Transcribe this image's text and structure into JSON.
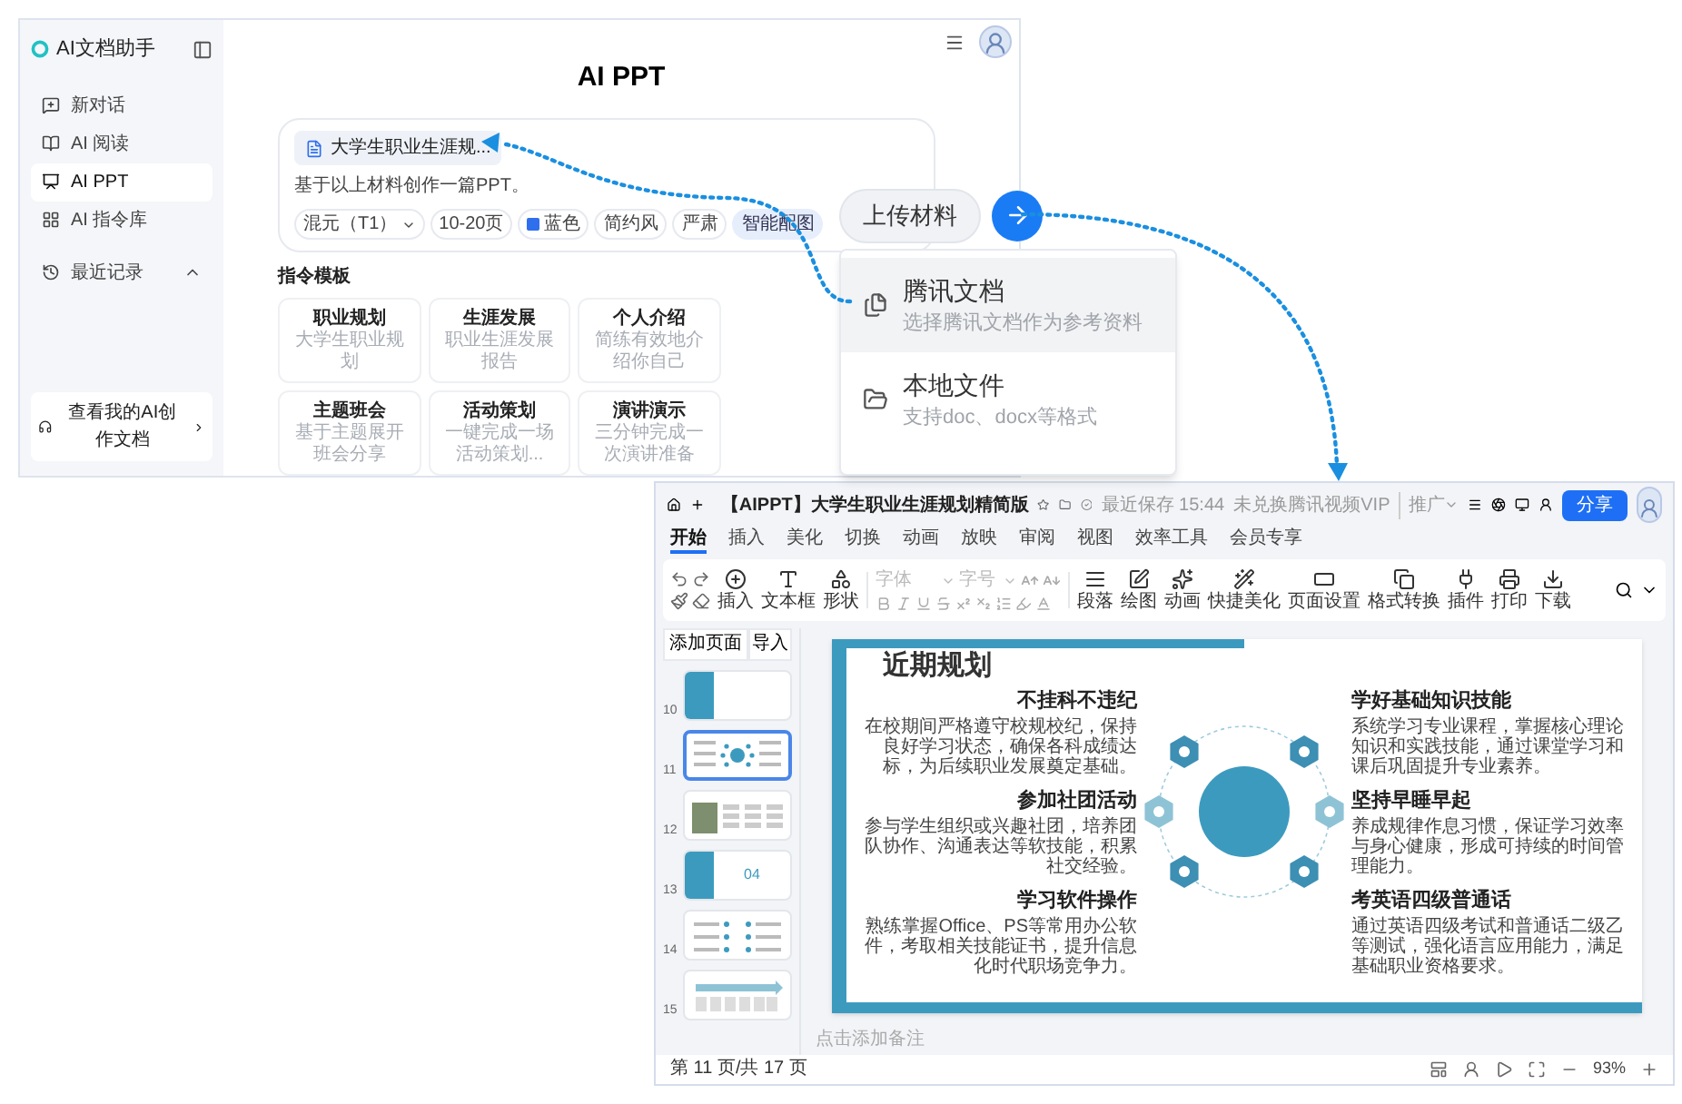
{
  "assistant": {
    "title": "AI文档助手",
    "nav": [
      {
        "label": "新对话",
        "selected": false
      },
      {
        "label": "AI 阅读",
        "selected": false
      },
      {
        "label": "AI PPT",
        "selected": true
      },
      {
        "label": "AI 指令库",
        "selected": false
      }
    ],
    "history": {
      "label": "最近记录",
      "expanded": true
    },
    "footer_link": "查看我的AI创作文档",
    "heading": "AI PPT",
    "attachment": "大学生职业生涯规...",
    "prompt": "基于以上材料创作一篇PPT。",
    "options": [
      {
        "kind": "select",
        "label": "混元（T1）"
      },
      {
        "kind": "chip",
        "label": "10-20页"
      },
      {
        "kind": "color",
        "label": "蓝色",
        "color": "#2f6fed"
      },
      {
        "kind": "chip",
        "label": "简约风"
      },
      {
        "kind": "chip",
        "label": "严肃"
      },
      {
        "kind": "toggle",
        "label": "智能配图",
        "selected": true
      }
    ],
    "templates_title": "指令模板",
    "templates": [
      {
        "title": "职业规划",
        "desc": "大学生职业规划"
      },
      {
        "title": "生涯发展",
        "desc": "职业生涯发展报告"
      },
      {
        "title": "个人介绍",
        "desc": "简练有效地介绍你自己"
      },
      {
        "title": "主题班会",
        "desc": "基于主题展开班会分享"
      },
      {
        "title": "活动策划",
        "desc": "一键完成一场活动策划..."
      },
      {
        "title": "演讲演示",
        "desc": "三分钟完成一次演讲准备"
      }
    ]
  },
  "upload": {
    "button": "上传材料",
    "menu": [
      {
        "title": "腾讯文档",
        "subtitle": "选择腾讯文档作为参考资料",
        "selected": true
      },
      {
        "title": "本地文件",
        "subtitle": "支持doc、docx等格式",
        "selected": false
      }
    ]
  },
  "editor": {
    "doc_title": "【AIPPT】大学生职业生涯规划精简版",
    "save_status": "最近保存 15:44",
    "vip": "未兑换腾讯视频VIP",
    "vip_menu": "推广",
    "share": "分享",
    "menu_tabs": [
      {
        "label": "开始",
        "selected": true
      },
      {
        "label": "插入",
        "selected": false
      },
      {
        "label": "美化",
        "selected": false
      },
      {
        "label": "切换",
        "selected": false
      },
      {
        "label": "动画",
        "selected": false
      },
      {
        "label": "放映",
        "selected": false
      },
      {
        "label": "审阅",
        "selected": false
      },
      {
        "label": "视图",
        "selected": false
      },
      {
        "label": "效率工具",
        "selected": false
      },
      {
        "label": "会员专享",
        "selected": false
      }
    ],
    "tools_left": [
      "插入",
      "文本框",
      "形状"
    ],
    "font_placeholder": "字体",
    "size_placeholder": "字号",
    "tools_right": [
      "段落",
      "绘图",
      "动画",
      "快捷美化",
      "页面设置",
      "格式转换",
      "插件",
      "打印",
      "下载"
    ],
    "slide_buttons": [
      "添加页面",
      "导入"
    ],
    "thumbnails": [
      {
        "number": "10",
        "kind": "section",
        "selected": false
      },
      {
        "number": "11",
        "kind": "diagram",
        "selected": true
      },
      {
        "number": "12",
        "kind": "photo",
        "selected": false
      },
      {
        "number": "13",
        "kind": "section",
        "label": "04",
        "selected": false
      },
      {
        "number": "14",
        "kind": "list",
        "selected": false
      },
      {
        "number": "15",
        "kind": "timeline",
        "selected": false
      }
    ],
    "slide": {
      "title": "近期规划",
      "left": [
        {
          "title": "不挂科不违纪",
          "text": "在校期间严格遵守校规校纪，保持良好学习状态，确保各科成绩达标，为后续职业发展奠定基础。"
        },
        {
          "title": "参加社团活动",
          "text": "参与学生组织或兴趣社团，培养团队协作、沟通表达等软技能，积累社交经验。"
        },
        {
          "title": "学习软件操作",
          "text": "熟练掌握Office、PS等常用办公软件，考取相关技能证书，提升信息化时代职场竞争力。"
        }
      ],
      "right": [
        {
          "title": "学好基础知识技能",
          "text": "系统学习专业课程，掌握核心理论知识和实践技能，通过课堂学习和课后巩固提升专业素养。"
        },
        {
          "title": "坚持早睡早起",
          "text": "养成规律作息习惯，保证学习效率与身心健康，形成可持续的时间管理能力。"
        },
        {
          "title": "考英语四级普通话",
          "text": "通过英语四级考试和普通话二级乙等测试，强化语言应用能力，满足基础职业资格要求。"
        }
      ]
    },
    "notes_placeholder": "点击添加备注",
    "status": "第 11 页/共 17 页",
    "zoom": "93%"
  }
}
